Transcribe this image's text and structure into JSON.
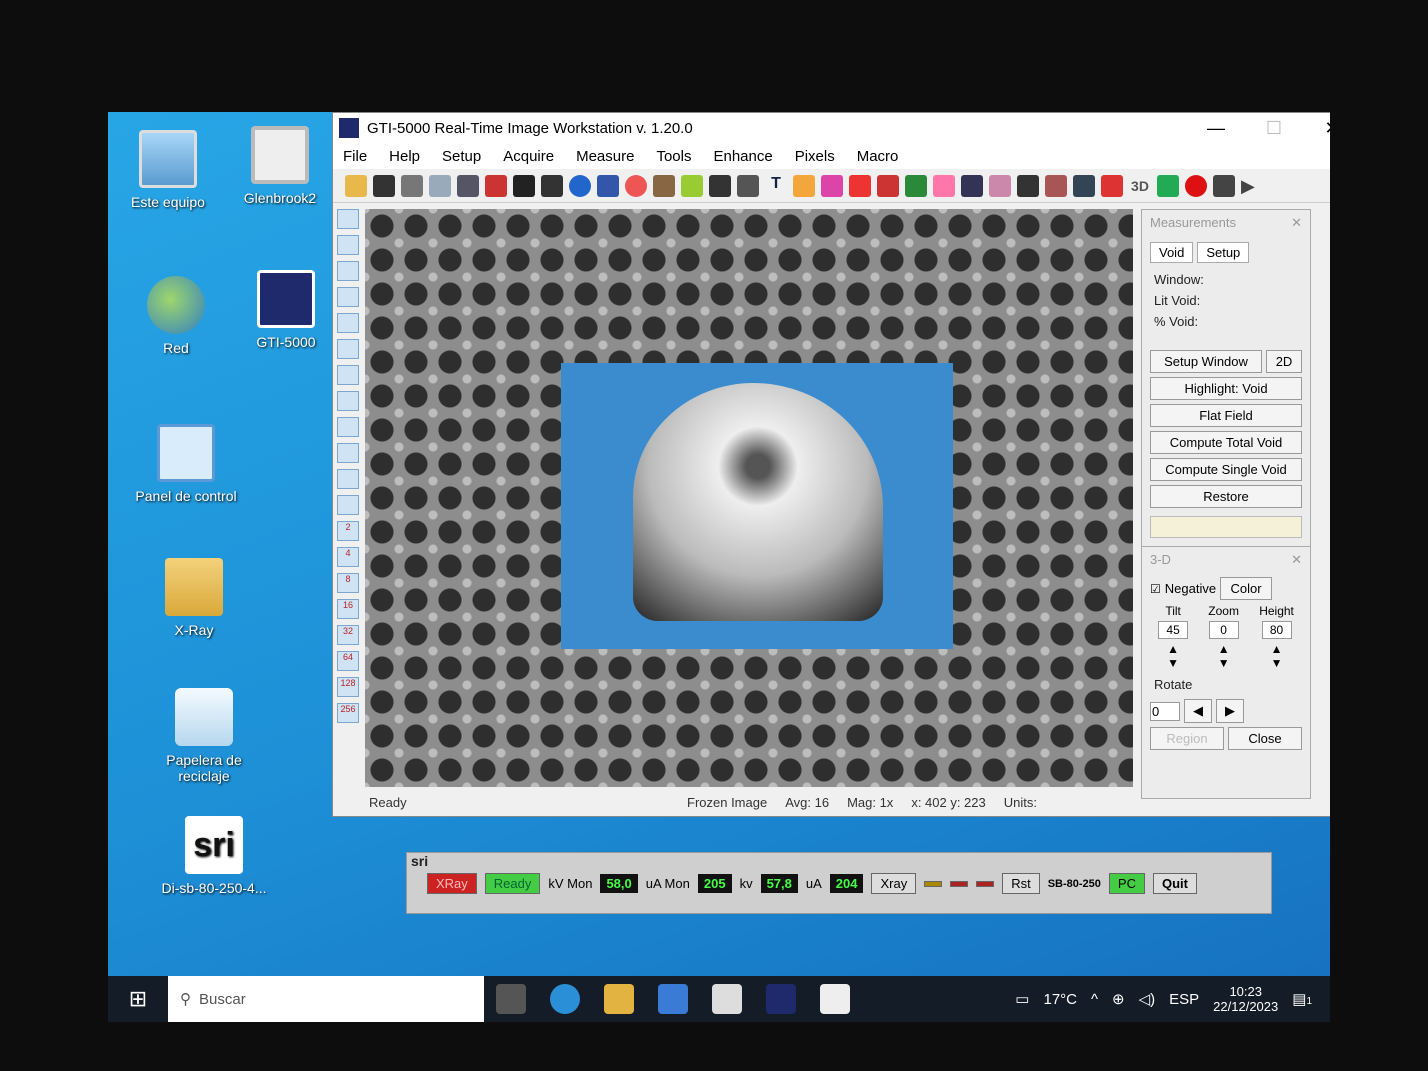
{
  "desktop": {
    "icons": [
      {
        "label": "Este equipo",
        "icon": "computer-icon"
      },
      {
        "label": "Glenbrook2",
        "icon": "shortcut-icon"
      },
      {
        "label": "Red",
        "icon": "network-icon"
      },
      {
        "label": "GTI-5000",
        "icon": "gti-app-icon"
      },
      {
        "label": "Panel de control",
        "icon": "control-panel-icon"
      },
      {
        "label": "X-Ray",
        "icon": "user-folder-icon"
      },
      {
        "label": "Papelera de reciclaje",
        "icon": "recycle-bin-icon"
      },
      {
        "label": "Di-sb-80-250-4...",
        "icon": "sri-app-icon"
      }
    ]
  },
  "app": {
    "title": "GTI-5000 Real-Time Image Workstation v. 1.20.0",
    "controls": {
      "minimize": "—",
      "maximize": "☐",
      "close": "✕"
    },
    "menu": [
      "File",
      "Help",
      "Setup",
      "Acquire",
      "Measure",
      "Tools",
      "Enhance",
      "Pixels",
      "Macro"
    ],
    "toolbar_3d": "3D",
    "left_tool_numbers": [
      "2",
      "4",
      "8",
      "16",
      "32",
      "64",
      "128",
      "256"
    ]
  },
  "status": {
    "ready": "Ready",
    "frozen": "Frozen Image",
    "avg": "Avg: 16",
    "mag": "Mag: 1x",
    "coords": "x: 402  y: 223",
    "units": "Units:"
  },
  "measurements": {
    "title": "Measurements",
    "close": "✕",
    "tabs": [
      "Void",
      "Setup"
    ],
    "labels": [
      "Window:",
      "Lit Void:",
      "% Void:"
    ],
    "setup_window": "Setup Window",
    "mode": "2D",
    "buttons": [
      "Highlight: Void",
      "Flat Field",
      "Compute Total Void",
      "Compute Single Void",
      "Restore"
    ]
  },
  "threed": {
    "title": "3-D",
    "close": "✕",
    "negative": "Negative",
    "color": "Color",
    "tilt_label": "Tilt",
    "tilt": "45",
    "zoom_label": "Zoom",
    "zoom": "0",
    "height_label": "Height",
    "height": "80",
    "rotate_label": "Rotate",
    "rotate": "0",
    "region": "Region",
    "close_btn": "Close"
  },
  "sri": {
    "title": "sri",
    "xray": "XRay",
    "ready": "Ready",
    "kv_mon_label": "kV Mon",
    "kv_mon": "58,0",
    "ua_mon_label": "uA Mon",
    "ua_mon": "205",
    "kv_label": "kv",
    "kv": "57,8",
    "ua_label": "uA",
    "ua": "204",
    "xray_btn": "Xray",
    "rst": "Rst",
    "model": "SB-80-250",
    "pc": "PC",
    "quit": "Quit"
  },
  "taskbar": {
    "search_placeholder": "Buscar",
    "weather": "17°C",
    "language": "ESP",
    "time": "10:23",
    "date": "22/12/2023",
    "notifications": "1"
  }
}
